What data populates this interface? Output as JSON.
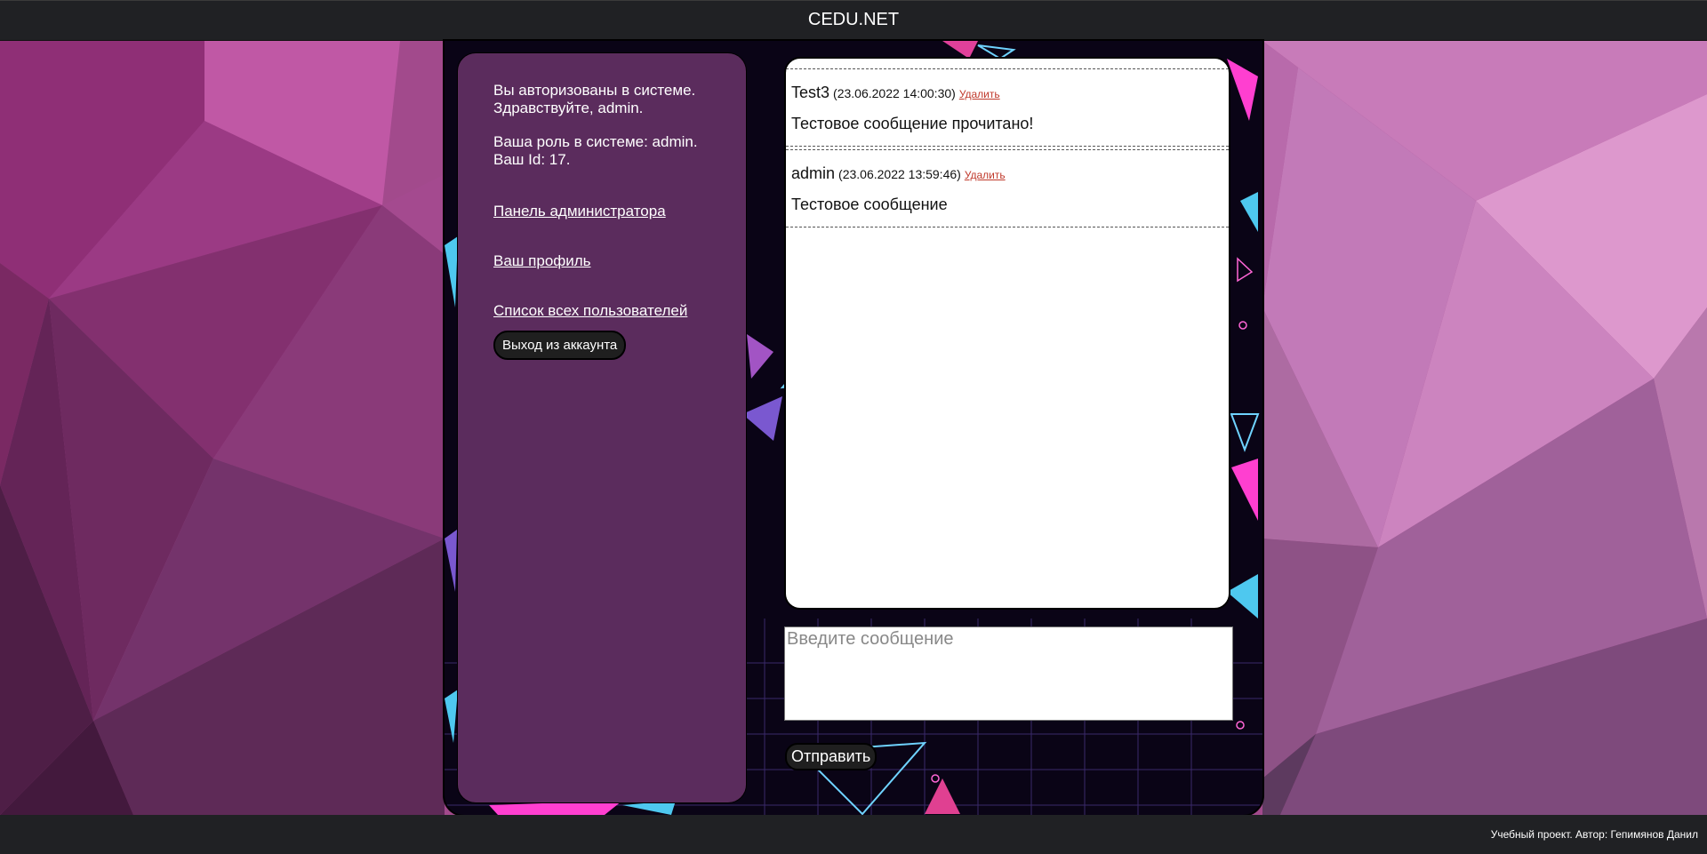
{
  "header": {
    "title": "CEDU.NET"
  },
  "sidebar": {
    "auth_line1": "Вы авторизованы в системе.",
    "auth_line2": "Здравствуйте, admin.",
    "role_line": "Ваша роль в системе: admin.",
    "id_line": "Ваш Id: 17.",
    "links": {
      "admin_panel": "Панель администратора",
      "profile": "Ваш профиль",
      "users_list": "Список всех пользователей"
    },
    "logout_label": "Выход из аккаунта"
  },
  "chat": {
    "messages": [
      {
        "author": "Test3",
        "date": "(23.06.2022 14:00:30)",
        "delete_label": "Удалить",
        "text": "Тестовое сообщение прочитано!"
      },
      {
        "author": "admin",
        "date": "(23.06.2022 13:59:46)",
        "delete_label": "Удалить",
        "text": "Тестовое сообщение"
      }
    ]
  },
  "composer": {
    "placeholder": "Введите сообщение",
    "send_label": "Отправить"
  },
  "footer": {
    "text": "Учебный проект. Автор: Гепимянов Данил"
  },
  "colors": {
    "background": "#a24a8c",
    "sidebar": "#5b2c5d",
    "delete_link": "#c0392b"
  }
}
